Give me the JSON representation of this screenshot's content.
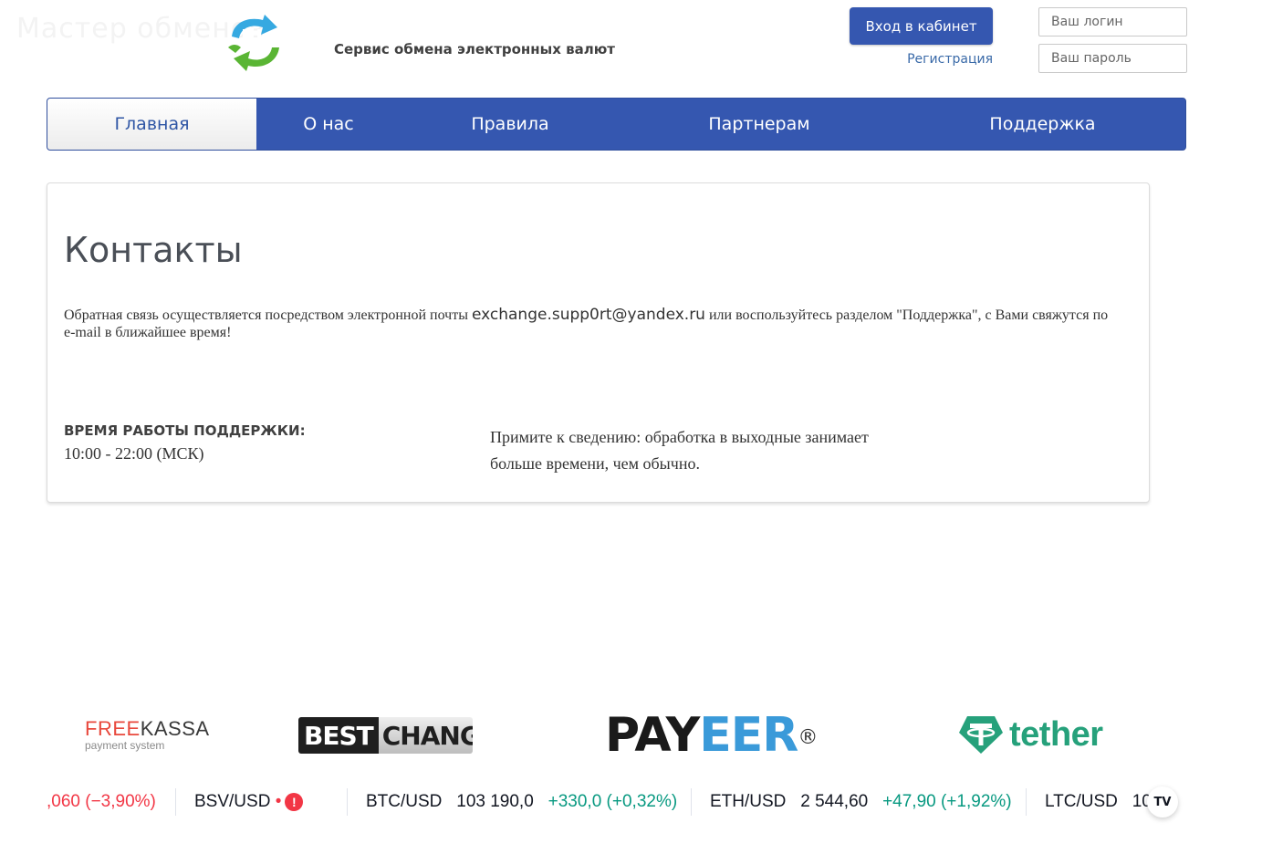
{
  "header": {
    "watermark": "Мастер обменов",
    "tagline": "Сервис обмена электронных валют",
    "login_button": "Вход в кабинет",
    "register_link": "Регистрация",
    "login_placeholder": "Ваш логин",
    "password_placeholder": "Ваш пароль"
  },
  "nav": {
    "items": [
      {
        "label": "Главная",
        "active": true
      },
      {
        "label": "О нас",
        "active": false
      },
      {
        "label": "Правила",
        "active": false
      },
      {
        "label": "Партнерам",
        "active": false
      },
      {
        "label": "Поддержка",
        "active": false
      }
    ]
  },
  "content": {
    "title": "Контакты",
    "para_before": "Обратная связь осуществляется посредством электронной почты ",
    "email": "exchange.supp0rt@yandex.ru",
    "para_after": "  или воспользуйтесь разделом \"Поддержка\", с Вами свяжутся по e-mail в ближайшее время!",
    "hours_heading": "ВРЕМЯ РАБОТЫ ПОДДЕРЖКИ:",
    "hours_value": "10:00 - 22:00 (МСК)",
    "note": "Примите к сведению: обработка в выходные занимает больше времени, чем обычно."
  },
  "partners": {
    "freekassa_a": "FREE",
    "freekassa_b": "KASSA",
    "freekassa_sub": "payment system",
    "bestchange_a": "BEST",
    "bestchange_b": "CHANGE",
    "payeer_a": "PAY",
    "payeer_b": "EER",
    "payeer_mark": "®",
    "tether": "tether",
    "colors": {
      "freekassa_red": "#e8483c",
      "payeer_blue": "#3a9ad9",
      "tether_green": "#26a17b"
    }
  },
  "ticker": {
    "items": [
      {
        "pair": "",
        "price": "",
        "change": ",060 (−3,90%)",
        "dir": "neg"
      },
      {
        "pair": "BSV/USD",
        "price": "",
        "change": "•",
        "dir": "neg"
      },
      {
        "pair": "BTC/USD",
        "price": "103 190,0",
        "change": "+330,0 (+0,32%)",
        "dir": "pos"
      },
      {
        "pair": "ETH/USD",
        "price": "2 544,60",
        "change": "+47,90 (+1,92%)",
        "dir": "pos"
      },
      {
        "pair": "LTC/USD",
        "price": "10",
        "change": "",
        "dir": "pos"
      }
    ],
    "badge": "TV"
  }
}
